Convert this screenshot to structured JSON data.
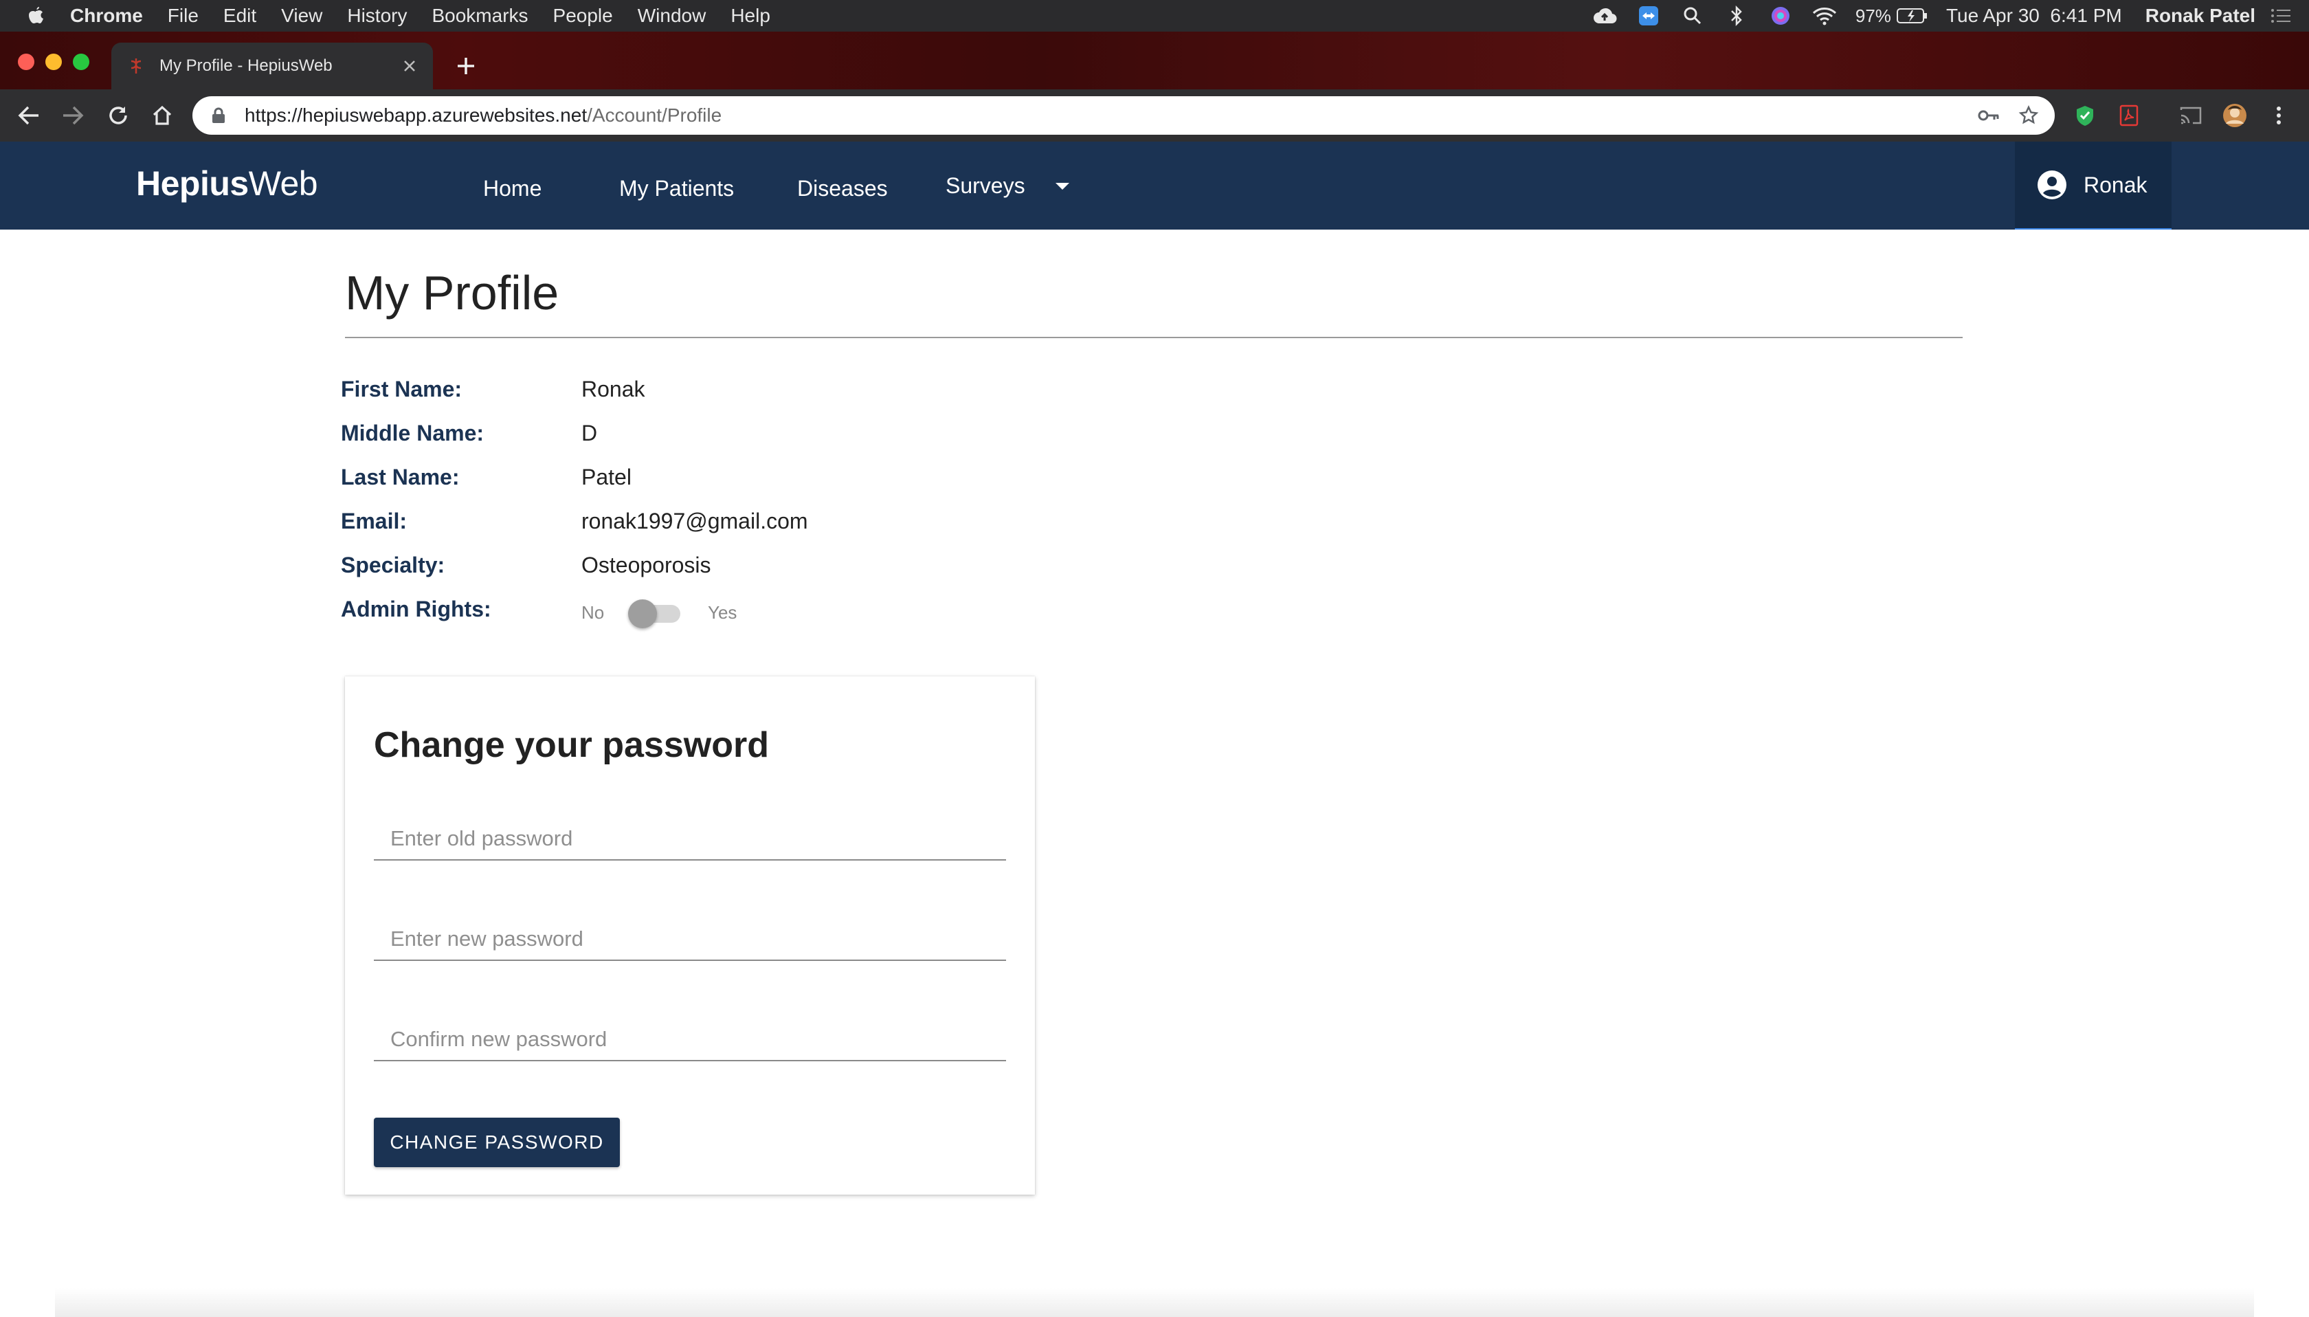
{
  "menubar": {
    "app": "Chrome",
    "items": [
      "File",
      "Edit",
      "View",
      "History",
      "Bookmarks",
      "People",
      "Window",
      "Help"
    ],
    "battery": "97%",
    "datetime": "Tue Apr 30  6:41 PM",
    "user": "Ronak Patel"
  },
  "browser": {
    "tab_title": "My Profile - HepiusWeb",
    "url_host": "https://hepiuswebapp.azurewebsites.net",
    "url_path": "/Account/Profile"
  },
  "navbar": {
    "brand_bold": "Hepius",
    "brand_light": "Web",
    "items": [
      "Home",
      "My Patients",
      "Diseases",
      "Surveys"
    ],
    "user_name": "Ronak",
    "colors": {
      "navbar": "#1b3353",
      "accent": "#3b86e6"
    }
  },
  "profile": {
    "title": "My Profile",
    "fields": [
      {
        "label": "First Name:",
        "value": "Ronak"
      },
      {
        "label": "Middle Name:",
        "value": "D"
      },
      {
        "label": "Last Name:",
        "value": "Patel"
      },
      {
        "label": "Email:",
        "value": "ronak1997@gmail.com"
      },
      {
        "label": "Specialty:",
        "value": "Osteoporosis"
      }
    ],
    "admin_label": "Admin Rights:",
    "admin_no": "No",
    "admin_yes": "Yes",
    "admin_enabled": false
  },
  "password_card": {
    "title": "Change your password",
    "old_placeholder": "Enter old password",
    "new_placeholder": "Enter new password",
    "confirm_placeholder": "Confirm new password",
    "button_label": "CHANGE PASSWORD"
  }
}
